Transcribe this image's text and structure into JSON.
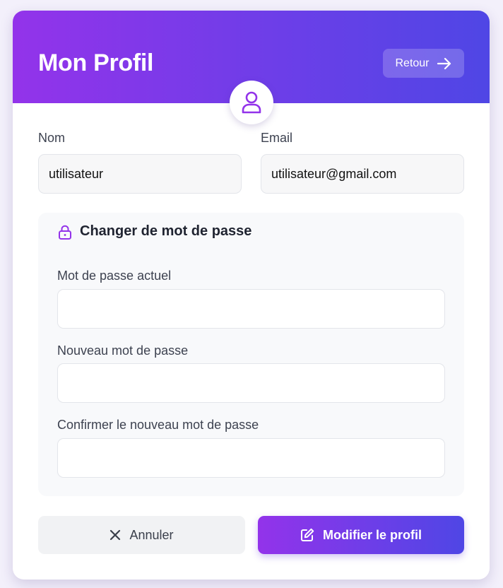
{
  "header": {
    "title": "Mon Profil",
    "back_label": "Retour"
  },
  "profile": {
    "name_label": "Nom",
    "name_value": "utilisateur",
    "email_label": "Email",
    "email_value": "utilisateur@gmail.com"
  },
  "password": {
    "section_title": "Changer de mot de passe",
    "current_label": "Mot de passe actuel",
    "current_value": "",
    "new_label": "Nouveau mot de passe",
    "new_value": "",
    "confirm_label": "Confirmer le nouveau mot de passe",
    "confirm_value": ""
  },
  "actions": {
    "cancel_label": "Annuler",
    "submit_label": "Modifier le profil"
  },
  "icons": {
    "back": "arrow-right-icon",
    "avatar": "user-icon",
    "lock": "lock-icon",
    "cancel": "close-icon",
    "submit": "edit-icon"
  },
  "colors": {
    "gradient_start": "#9333ea",
    "gradient_end": "#4f46e5",
    "accent": "#9333ea"
  }
}
